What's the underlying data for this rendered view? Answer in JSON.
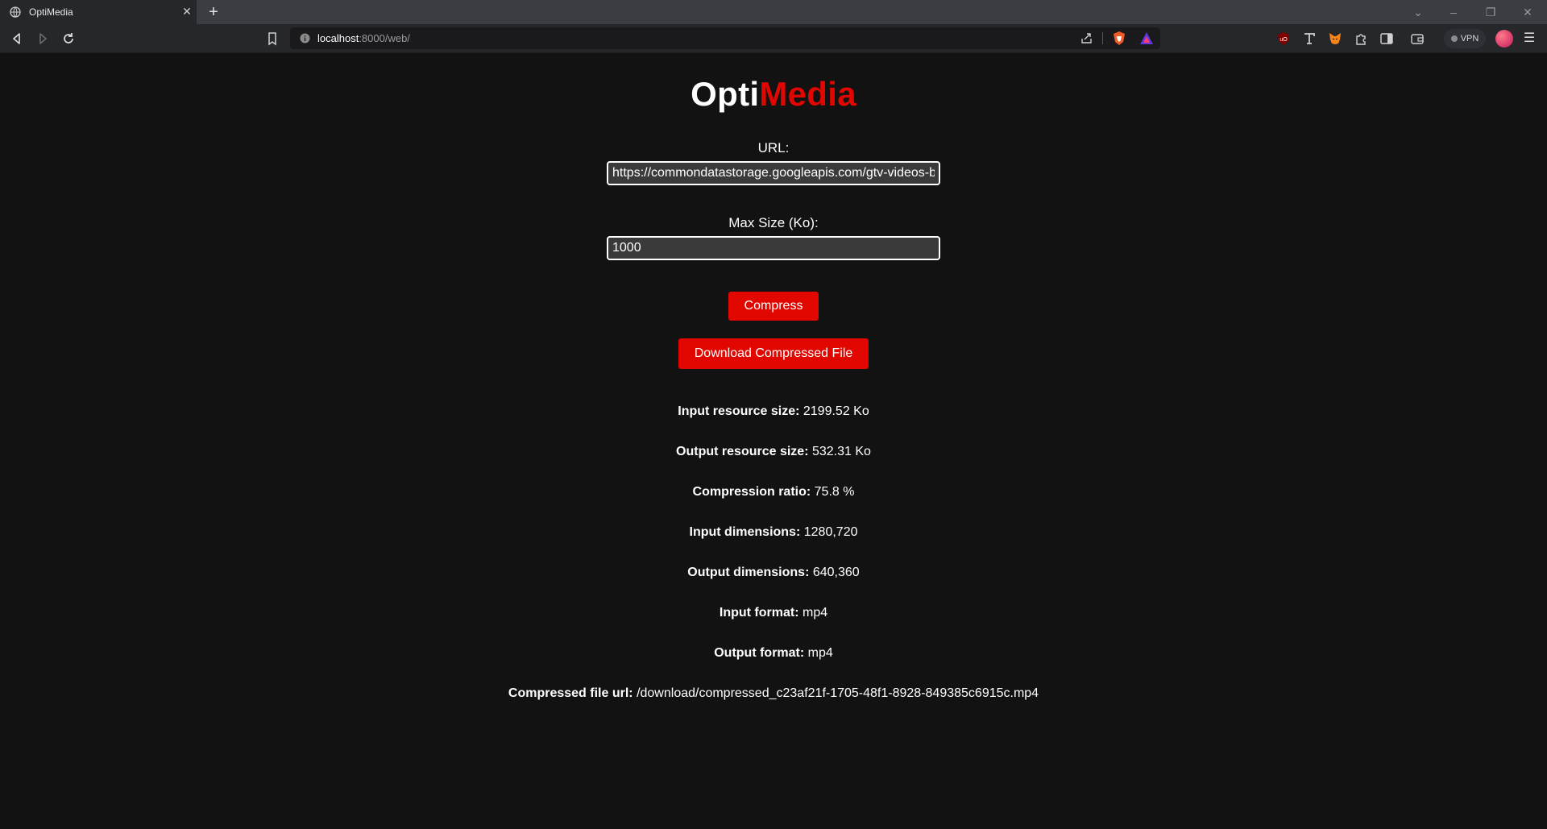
{
  "browser": {
    "tab_title": "OptiMedia",
    "address_host": "localhost",
    "address_path": ":8000/web/",
    "vpn_label": "VPN"
  },
  "app": {
    "logo_part1": "Opti",
    "logo_part2": "Media",
    "url_label": "URL:",
    "url_value": "https://commondatastorage.googleapis.com/gtv-videos-b",
    "maxsize_label": "Max Size (Ko):",
    "maxsize_value": "1000",
    "compress_label": "Compress",
    "download_label": "Download Compressed File"
  },
  "results": [
    {
      "label": "Input resource size:",
      "value": "2199.52 Ko"
    },
    {
      "label": "Output resource size:",
      "value": "532.31 Ko"
    },
    {
      "label": "Compression ratio:",
      "value": "75.8 %"
    },
    {
      "label": "Input dimensions:",
      "value": "1280,720"
    },
    {
      "label": "Output dimensions:",
      "value": "640,360"
    },
    {
      "label": "Input format:",
      "value": "mp4"
    },
    {
      "label": "Output format:",
      "value": "mp4"
    },
    {
      "label": "Compressed file url:",
      "value": "/download/compressed_c23af21f-1705-48f1-8928-849385c6915c.mp4"
    }
  ],
  "colors": {
    "accent": "#e10600",
    "background": "#121212"
  }
}
